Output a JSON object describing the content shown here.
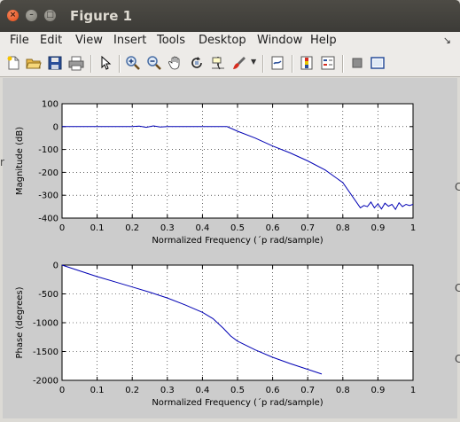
{
  "window": {
    "title": "Figure 1"
  },
  "menu": [
    "File",
    "Edit",
    "View",
    "Insert",
    "Tools",
    "Desktop",
    "Window",
    "Help"
  ],
  "toolbar_icons": [
    "new-figure-icon",
    "open-file-icon",
    "save-icon",
    "print-icon",
    "edit-plot-arrow-icon",
    "zoom-in-icon",
    "zoom-out-icon",
    "pan-hand-icon",
    "rotate-3d-icon",
    "data-cursor-icon",
    "brush-icon",
    "brush-dropdown-icon",
    "link-plot-icon",
    "colorbar-icon",
    "legend-icon",
    "hide-plot-tools-icon",
    "show-plot-tools-icon"
  ],
  "colors": {
    "line": "#0000b4",
    "figure_bg": "#cccccc",
    "axes_bg": "#ffffff"
  },
  "chart_data": [
    {
      "type": "line",
      "xlabel": "Normalized Frequency  (´p rad/sample)",
      "ylabel": "Magnitude (dB)",
      "xlim": [
        0,
        1
      ],
      "ylim": [
        -400,
        100
      ],
      "xticks": [
        "0",
        "0.1",
        "0.2",
        "0.3",
        "0.4",
        "0.5",
        "0.6",
        "0.7",
        "0.8",
        "0.9",
        "1"
      ],
      "yticks": [
        "100",
        "0",
        "-100",
        "-200",
        "-300",
        "-400"
      ],
      "grid": true,
      "series": [
        {
          "x": [
            0,
            0.2,
            0.22,
            0.24,
            0.26,
            0.28,
            0.3,
            0.47,
            0.5,
            0.55,
            0.6,
            0.65,
            0.7,
            0.75,
            0.8,
            0.85,
            0.86,
            0.87,
            0.88,
            0.89,
            0.9,
            0.91,
            0.92,
            0.93,
            0.94,
            0.95,
            0.96,
            0.97,
            0.98,
            0.99,
            1.0
          ],
          "y": [
            0,
            0,
            2,
            -3,
            3,
            -2,
            0,
            0,
            -20,
            -50,
            -85,
            -115,
            -150,
            -190,
            -245,
            -355,
            -345,
            -350,
            -330,
            -355,
            -338,
            -360,
            -335,
            -348,
            -340,
            -362,
            -333,
            -350,
            -340,
            -345,
            -340
          ]
        }
      ]
    },
    {
      "type": "line",
      "xlabel": "Normalized Frequency  (´p rad/sample)",
      "ylabel": "Phase (degrees)",
      "xlim": [
        0,
        1
      ],
      "ylim": [
        -2000,
        0
      ],
      "xticks": [
        "0",
        "0.1",
        "0.2",
        "0.3",
        "0.4",
        "0.5",
        "0.6",
        "0.7",
        "0.8",
        "0.9",
        "1"
      ],
      "yticks": [
        "0",
        "-500",
        "-1000",
        "-1500",
        "-2000"
      ],
      "grid": true,
      "series": [
        {
          "x": [
            0,
            0.05,
            0.1,
            0.15,
            0.2,
            0.25,
            0.3,
            0.35,
            0.4,
            0.43,
            0.46,
            0.48,
            0.5,
            0.55,
            0.6,
            0.65,
            0.7,
            0.74
          ],
          "y": [
            0,
            -100,
            -200,
            -290,
            -380,
            -470,
            -570,
            -690,
            -820,
            -930,
            -1100,
            -1230,
            -1320,
            -1470,
            -1600,
            -1710,
            -1810,
            -1890
          ]
        }
      ]
    }
  ]
}
